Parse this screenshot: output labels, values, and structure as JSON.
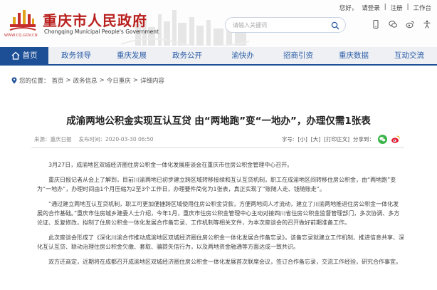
{
  "header": {
    "title": "重庆市人民政府",
    "subtitle": "Chongqing Municipal People's Government",
    "logo_url": "WWW.CQ.GOV.CN",
    "search_placeholder": "请输入关键词",
    "top_links": [
      "您好，",
      "请登录",
      "|",
      "注册",
      "|",
      "工作台"
    ],
    "tool_icons": [
      "phone-icon",
      "wechat-icon",
      "weibo-icon",
      "accessibility-icon"
    ]
  },
  "nav": {
    "items": [
      "首页",
      "政务领导",
      "重庆发展",
      "政务公开",
      "渝快办",
      "招商引资",
      "重庆数据",
      "互动交流"
    ],
    "active_index": 0,
    "active_color": "#1d4f97",
    "text_color": "#2a5ca6"
  },
  "breadcrumb": {
    "prefix": "您的位置：",
    "items": [
      "首页",
      ">",
      "政务信息",
      ">",
      "今日重庆",
      ">",
      "详细内容"
    ]
  },
  "article": {
    "title": "成渝两地公积金实现互认互贷 由“两地跑”变“一地办”，办理仅需1张表",
    "source": "来源：重庆日报",
    "time": "发布时间：2020-03-30 06:50",
    "font_label": "字号:",
    "font_small": "[小]",
    "font_large": "[大]",
    "print": "[打印正文]",
    "share_label": "分享到：",
    "paragraphs": [
      "3月27日，成渝地区双城经济圈住房公积金一体化发展座谈会在重庆市住房公积金管理中心召开。",
      "重庆日报记者从会上了解到，目前川渝两地已初步建立跨区域转移接续和互认互贷机制，职工在成渝地区间转移住房公积金，由“两地跑”变为“一地办”，办理时间由1个月压缩为2至3个工作日，办理要件简化为1张表，真正实现了“账随人走、钱随账走”。",
      "“通过建立两地互认互贷机制，职工可更加便捷跨区域使用住房公积金贷款，方便两地间人才流动，建立了川渝两地推进住房公积金一体化发展的合作基础。”重庆市住房城乡建委人士介绍，今年1月，重庆市住房公积金管理中心主动对接四川省住房公积金监督管理部门，多次协调、多方论证、反复修改，拟制了住房公积金一体化发展合作备忘录、工作机制等相关文件，为本次座谈会的召开做好前期准备工作。",
      "此次座谈会形成了《深化川渝合作推动成渝地区双城经济圈住房公积金一体化发展合作备忘录》。该备忘录就建立工作机制、推进信息共享、深化互认互贷、联动治理住房公积金欠缴、套取、骗提失信行为，以及两地资金融通等方面达成一致共识。",
      "双方还商定，近期将在成都召开成渝地区双城经济圈住房公积金一体化发展首次联席会议，签订合作备忘录，交流工作经验，研究合作事宜。"
    ]
  },
  "colors": {
    "brand_red": "#b8201e",
    "nav_blue": "#1d4f97",
    "wechat_green": "#3bb44a",
    "weibo_red": "#e6162d"
  }
}
